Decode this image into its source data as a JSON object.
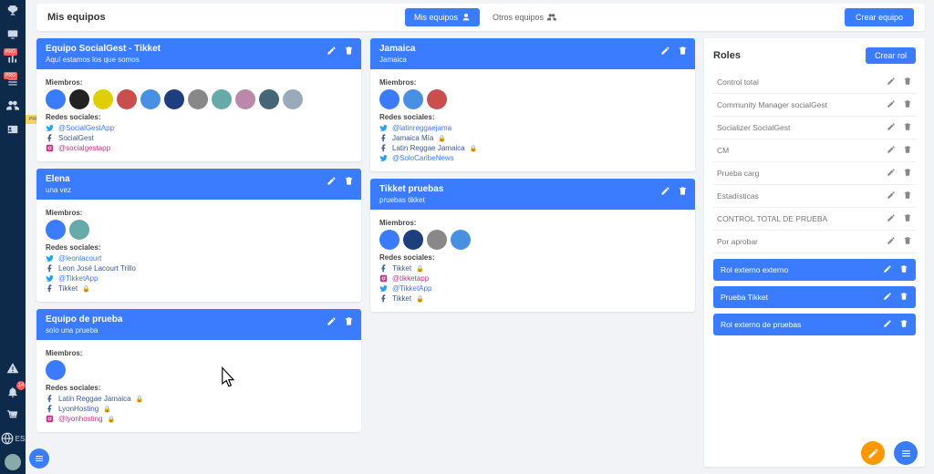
{
  "topbar": {
    "title": "Mis equipos",
    "tab_mine": "Mis equipos",
    "tab_others": "Otros equipos",
    "create": "Crear equipo"
  },
  "side_tag": "PRUEBAS",
  "lang": "ES",
  "notif_count": "14",
  "teams_left": [
    {
      "name": "Equipo SocialGest - Tikket",
      "desc": "Aquí estamos los que somos",
      "members_label": "Miembros:",
      "socials_label": "Redes sociales:",
      "avatars": [
        "a1",
        "a2",
        "a3",
        "a4",
        "a5",
        "a6",
        "a7",
        "a8",
        "a9",
        "a10",
        "a11"
      ],
      "socials": [
        {
          "net": "tw",
          "text": "@SocialGestApp"
        },
        {
          "net": "fb",
          "text": "SocialGest"
        },
        {
          "net": "ig",
          "text": "@socialgestapp"
        }
      ]
    },
    {
      "name": "Elena",
      "desc": "una vez",
      "members_label": "Miembros:",
      "socials_label": "Redes sociales:",
      "avatars": [
        "a1",
        "a8"
      ],
      "socials": [
        {
          "net": "tw",
          "text": "@leonlacourt"
        },
        {
          "net": "fb",
          "text": "Leon José Lacourt Trillo"
        },
        {
          "net": "tw",
          "text": "@TikketApp"
        },
        {
          "net": "fb",
          "text": "Tikket",
          "flag": "🔒"
        }
      ]
    },
    {
      "name": "Equipo de prueba",
      "desc": "solo una prueba",
      "members_label": "Miembros:",
      "socials_label": "Redes sociales:",
      "avatars": [
        "a1"
      ],
      "socials": [
        {
          "net": "fb",
          "text": "Latin Reggae Jamaica",
          "flag": "🔒"
        },
        {
          "net": "fb",
          "text": "LyonHosting",
          "flag": "🔒"
        },
        {
          "net": "ig",
          "text": "@lyonhosting",
          "flag": "🔒"
        }
      ]
    }
  ],
  "teams_right": [
    {
      "name": "Jamaica",
      "desc": "Jamaica",
      "members_label": "Miembros:",
      "socials_label": "Redes sociales:",
      "avatars": [
        "a1",
        "a5",
        "a4"
      ],
      "socials": [
        {
          "net": "tw",
          "text": "@latinreggaejama"
        },
        {
          "net": "fb",
          "text": "Jamaica Mía",
          "flag": "🔒"
        },
        {
          "net": "fb",
          "text": "Latin Reggae Jamaica",
          "flag": "🔒"
        },
        {
          "net": "tw",
          "text": "@SoloCaribeNews"
        }
      ]
    },
    {
      "name": "Tikket pruebas",
      "desc": "pruebas tikket",
      "members_label": "Miembros:",
      "socials_label": "Redes sociales:",
      "avatars": [
        "a1",
        "a6",
        "a7",
        "a5"
      ],
      "socials": [
        {
          "net": "fb",
          "text": "Tikket",
          "flag": "🔒"
        },
        {
          "net": "ig",
          "text": "@tikketapp"
        },
        {
          "net": "tw",
          "text": "@TikketApp"
        },
        {
          "net": "fb",
          "text": "Tikket",
          "flag": "🔒"
        }
      ]
    }
  ],
  "roles": {
    "title": "Roles",
    "create": "Crear rol",
    "list": [
      {
        "name": "Control total",
        "hl": false
      },
      {
        "name": "Community Manager socialGest",
        "hl": false
      },
      {
        "name": "Socializer SocialGest",
        "hl": false
      },
      {
        "name": "CM",
        "hl": false
      },
      {
        "name": "Prueba carg",
        "hl": false
      },
      {
        "name": "Estadísticas",
        "hl": false
      },
      {
        "name": "CONTROL TOTAL DE PRUEBA",
        "hl": false
      },
      {
        "name": "Por aprobar",
        "hl": false
      },
      {
        "name": "Rol externo externo",
        "hl": true
      },
      {
        "name": "Prueba Tikket",
        "hl": true
      },
      {
        "name": "Rol externo de pruebas",
        "hl": true
      }
    ]
  }
}
